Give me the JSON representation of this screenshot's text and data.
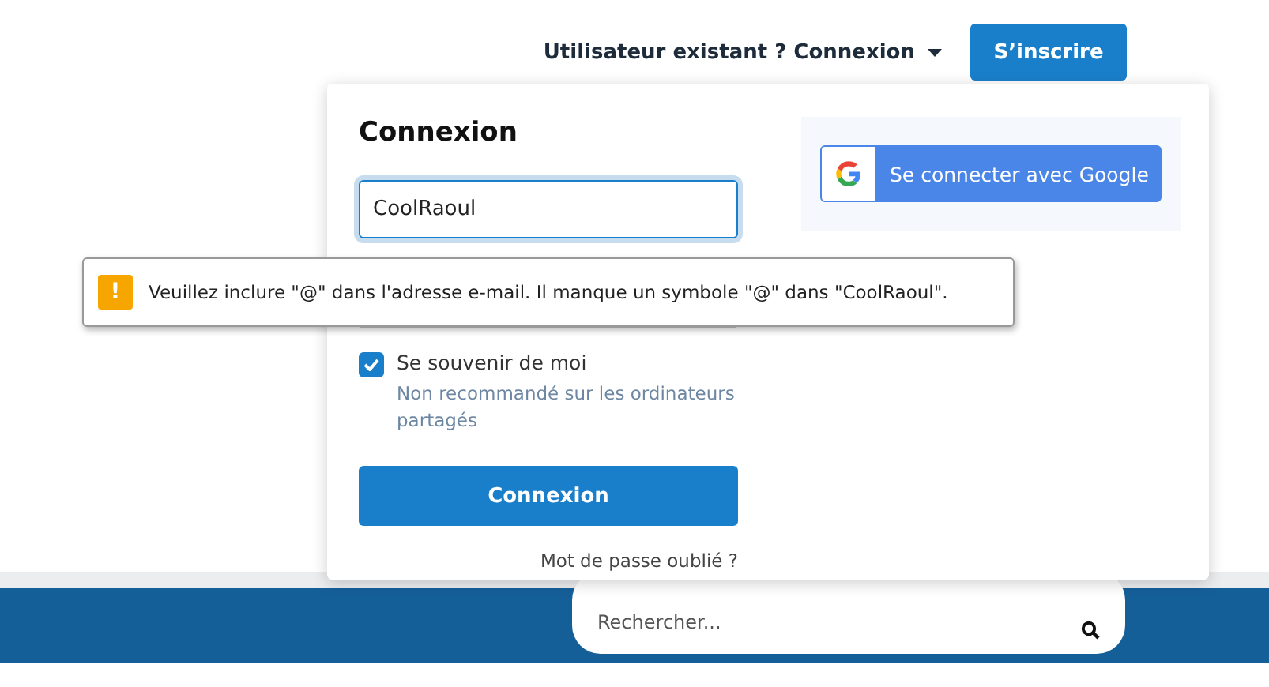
{
  "header": {
    "login_toggle": "Utilisateur existant ? Connexion",
    "signup_button": "S’inscrire"
  },
  "login_panel": {
    "title": "Connexion",
    "username_value": "CoolRaoul",
    "remember": {
      "label": "Se souvenir de moi",
      "hint": "Non recommandé sur les ordinateurs partagés",
      "checked": true
    },
    "submit_button": "Connexion",
    "forgot_link": "Mot de passe oublié ?",
    "google_button": "Se connecter avec Google"
  },
  "validation_tooltip": {
    "icon": "!",
    "message": "Veuillez inclure \"@\" dans l'adresse e-mail. Il manque un symbole \"@\" dans \"CoolRaoul\"."
  },
  "footer": {
    "search": {
      "placeholder": "Rechercher..."
    }
  }
}
